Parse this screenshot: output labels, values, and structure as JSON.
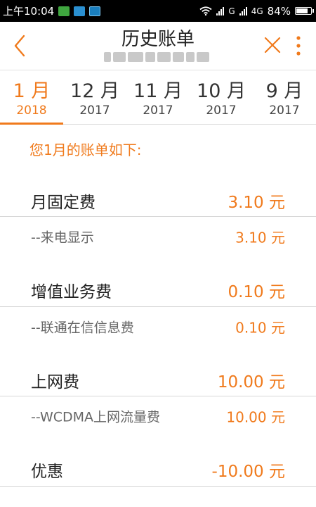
{
  "status_bar": {
    "time": "上午10:04",
    "signal_1": "G",
    "signal_2": "4G",
    "battery": "84%",
    "battery_level": 0.84
  },
  "header": {
    "title": "历史账单",
    "back_icon": "chevron-left-icon",
    "close_icon": "close-icon",
    "more_icon": "more-vertical-icon"
  },
  "tabs": [
    {
      "month": "1 月",
      "year": "2018",
      "active": true
    },
    {
      "month": "12 月",
      "year": "2017",
      "active": false
    },
    {
      "month": "11 月",
      "year": "2017",
      "active": false
    },
    {
      "month": "10 月",
      "year": "2017",
      "active": false
    },
    {
      "month": "9 月",
      "year": "2017",
      "active": false
    }
  ],
  "bill": {
    "intro": "您1月的账单如下:",
    "items": [
      {
        "label": "月固定费",
        "amount": "3.10 元"
      },
      {
        "label": "--来电显示",
        "amount": "3.10 元"
      },
      {
        "label": "增值业务费",
        "amount": "0.10 元"
      },
      {
        "label": "--联通在信信息费",
        "amount": "0.10 元"
      },
      {
        "label": "上网费",
        "amount": "10.00 元"
      },
      {
        "label": "--WCDMA上网流量费",
        "amount": "10.00 元"
      },
      {
        "label": "优惠",
        "amount": "-10.00 元"
      }
    ]
  },
  "colors": {
    "accent": "#f07a1c",
    "text": "#222222",
    "divider": "#d6d6d6"
  }
}
